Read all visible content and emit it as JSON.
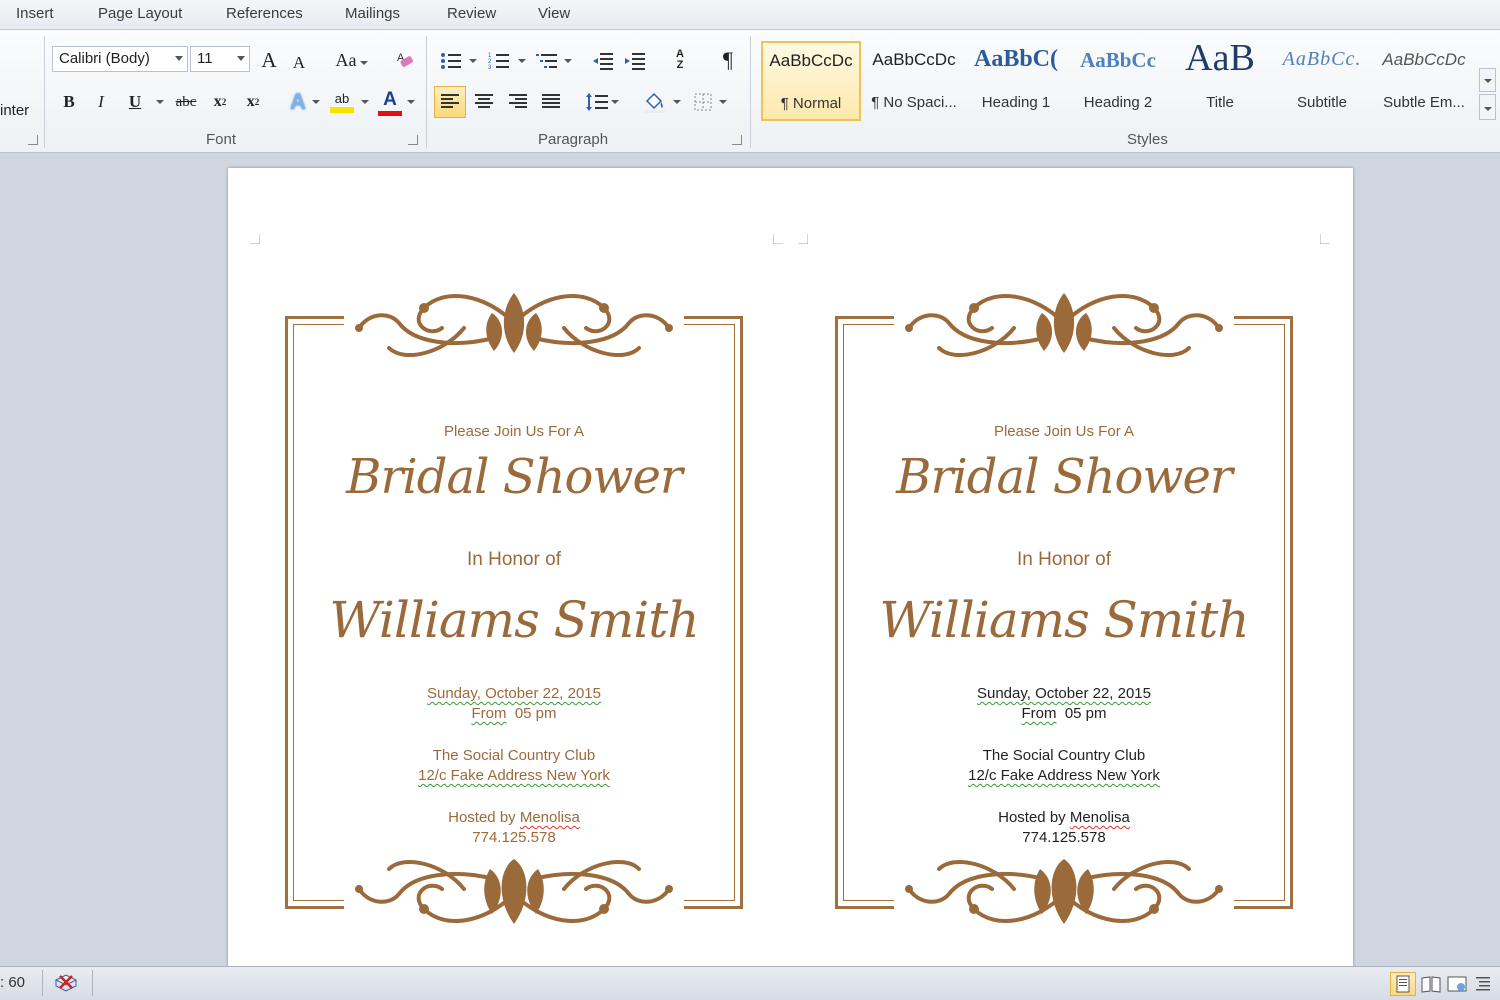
{
  "tabs": [
    "Insert",
    "Page Layout",
    "References",
    "Mailings",
    "Review",
    "View"
  ],
  "clipboard": {
    "partial_label": "inter"
  },
  "font": {
    "group_label": "Font",
    "family_value": "Calibri (Body)",
    "size_value": "11",
    "grow_label": "A",
    "shrink_label": "A",
    "case_label": "Aa",
    "bold_label": "B",
    "italic_label": "I",
    "underline_label": "U",
    "strike_label": "abc",
    "subscript_label": "x",
    "superscript_label": "x",
    "highlight_label": "ab",
    "color_label": "A",
    "highlight_color": "#f5e400",
    "font_color": "#e01010"
  },
  "paragraph": {
    "group_label": "Paragraph",
    "sort_label": "A Z",
    "pilcrow": "¶"
  },
  "styles": {
    "group_label": "Styles",
    "items": [
      {
        "sample": "AaBbCcDc",
        "name": "¶ Normal"
      },
      {
        "sample": "AaBbCcDc",
        "name": "¶ No Spaci..."
      },
      {
        "sample": "AaBbC(",
        "name": "Heading 1"
      },
      {
        "sample": "AaBbCc",
        "name": "Heading 2"
      },
      {
        "sample": "AaB",
        "name": "Title"
      },
      {
        "sample": "AaBbCc.",
        "name": "Subtitle"
      },
      {
        "sample": "AaBbCcDc",
        "name": "Subtle Em..."
      }
    ]
  },
  "invitation": {
    "intro": "Please Join Us For A",
    "event": "Bridal Shower",
    "honor": "In Honor of",
    "name": "Williams Smith",
    "date": "Sunday, October 22, 2015",
    "from_word": "From",
    "time": "05 pm",
    "venue": "The Social Country Club",
    "address": "12/c Fake Address New York",
    "hosted_prefix": "Hosted by",
    "host": "Menolisa",
    "phone": "774.125.578",
    "accent_color": "#9b6a3b"
  },
  "statusbar": {
    "zoom_partial": ": 60"
  }
}
